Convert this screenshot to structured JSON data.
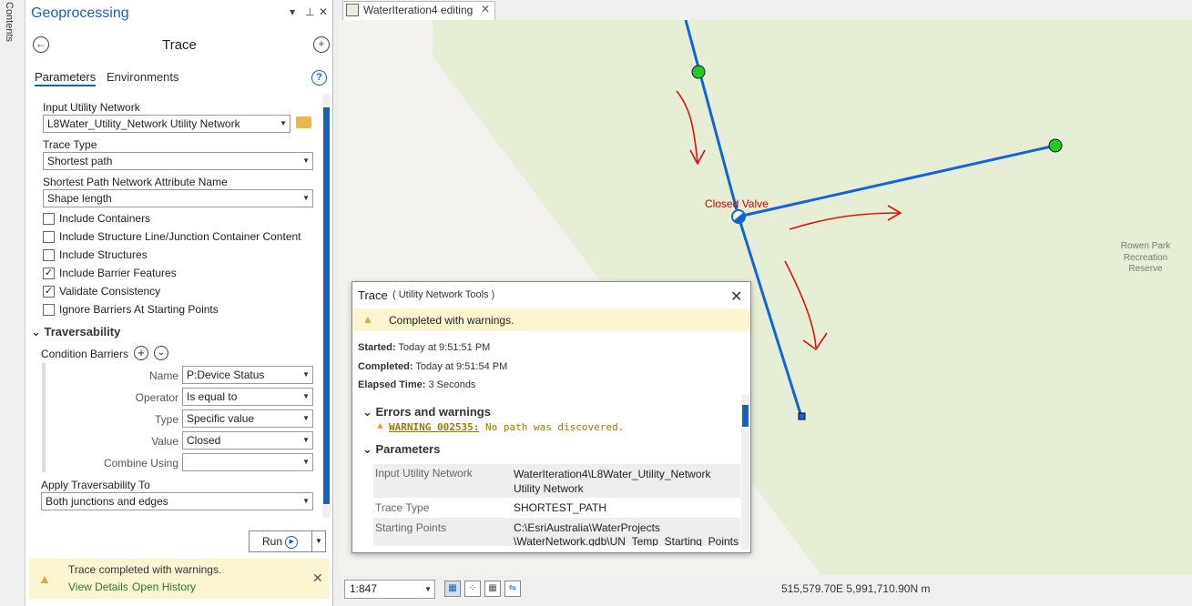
{
  "contents_label": "Contents",
  "gp": {
    "title": "Geoprocessing",
    "tool": "Trace",
    "tabs": [
      "Parameters",
      "Environments"
    ],
    "help": "?",
    "input_network_label": "Input Utility Network",
    "input_network_value": "L8Water_Utility_Network Utility Network",
    "trace_type_label": "Trace Type",
    "trace_type_value": "Shortest path",
    "sp_attr_label": "Shortest Path Network Attribute Name",
    "sp_attr_value": "Shape length",
    "checkboxes": [
      {
        "label": "Include Containers",
        "checked": false
      },
      {
        "label": "Include Structure Line/Junction Container Content",
        "checked": false
      },
      {
        "label": "Include Structures",
        "checked": false
      },
      {
        "label": "Include Barrier Features",
        "checked": true
      },
      {
        "label": "Validate Consistency",
        "checked": true
      },
      {
        "label": "Ignore Barriers At Starting Points",
        "checked": false
      }
    ],
    "traversability": "Traversability",
    "condition_barriers": "Condition Barriers",
    "cond": {
      "name_label": "Name",
      "name_value": "P:Device Status",
      "operator_label": "Operator",
      "operator_value": "Is equal to",
      "type_label": "Type",
      "type_value": "Specific value",
      "value_label": "Value",
      "value_value": "Closed",
      "combine_label": "Combine Using",
      "combine_value": ""
    },
    "apply_label": "Apply Traversability To",
    "apply_value": "Both junctions and edges",
    "run_label": "Run",
    "status_text": "Trace completed with warnings.",
    "view_details": "View Details",
    "open_history": "Open History"
  },
  "map": {
    "tab_label": "WaterIteration4 editing",
    "closed_valve": "Closed Valve",
    "park_label": "Rowen Park\nRecreation\nReserve",
    "scale": "1:847",
    "coords": "515,579.70E 5,991,710.90N m"
  },
  "popup": {
    "title": "Trace",
    "subtitle": "( Utility Network Tools )",
    "status": "Completed with warnings.",
    "started_label": "Started:",
    "started_value": "Today at 9:51:51 PM",
    "completed_label": "Completed:",
    "completed_value": "Today at 9:51:54 PM",
    "elapsed_label": "Elapsed Time:",
    "elapsed_value": "3 Seconds",
    "errors_header": "Errors and warnings",
    "warning_code": "WARNING 002535:",
    "warning_msg": " No path was discovered.",
    "params_header": "Parameters",
    "params": [
      {
        "k": "Input Utility Network",
        "v": "WaterIteration4\\L8Water_Utility_Network Utility Network"
      },
      {
        "k": "Trace Type",
        "v": "SHORTEST_PATH"
      },
      {
        "k": "Starting Points",
        "v": "C:\\EsriAustralia\\WaterProjects \\WaterNetwork.gdb\\UN_Temp_Starting_Points"
      }
    ]
  },
  "colors": {
    "accent": "#1a62b8",
    "line": "#1464d8",
    "start_point": "#22cc22",
    "annotation": "#e01010",
    "park": "#e6efd6"
  }
}
